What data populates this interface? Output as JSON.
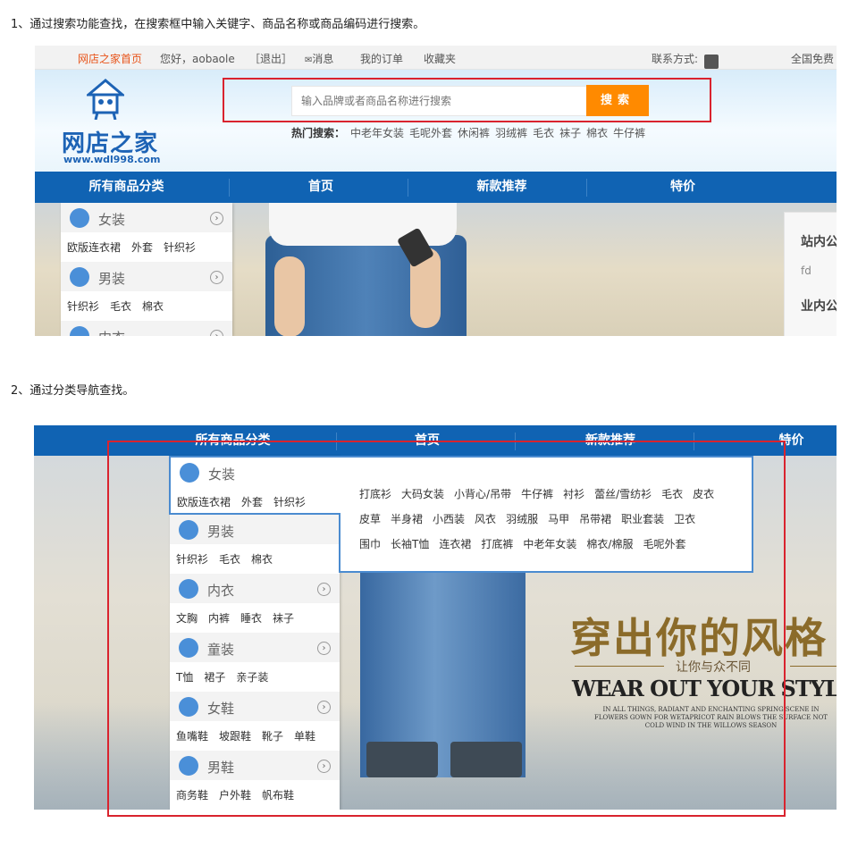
{
  "captions": {
    "step1": "1、通过搜索功能查找，在搜索框中输入关键字、商品名称或商品编码进行搜索。",
    "step2": "2、通过分类导航查找。"
  },
  "topbar": {
    "home": "网店之家首页",
    "greeting": "您好，aobaole",
    "logout": "［退出］",
    "messages": "消息",
    "orders": "我的订单",
    "favorites": "收藏夹",
    "contact": "联系方式:",
    "hotline": "全国免费"
  },
  "logo": {
    "name": "网店之家",
    "url": "www.wdl998.com"
  },
  "search": {
    "placeholder": "输入品牌或者商品名称进行搜索",
    "button": "搜索",
    "hot_label": "热门搜索：",
    "hot_terms": [
      "中老年女装",
      "毛呢外套",
      "休闲裤",
      "羽绒裤",
      "毛衣",
      "袜子",
      "棉衣",
      "牛仔裤"
    ]
  },
  "nav": {
    "all": "所有商品分类",
    "home": "首页",
    "new": "新款推荐",
    "sale": "特价"
  },
  "notice": {
    "site": "站内公",
    "item": "fd",
    "industry": "业内公"
  },
  "categories": [
    {
      "title": "女装",
      "icon": "dress-icon",
      "subs": [
        "欧版连衣裙",
        "外套",
        "针织衫"
      ]
    },
    {
      "title": "男装",
      "icon": "shirt-icon",
      "subs": [
        "针织衫",
        "毛衣",
        "棉衣"
      ]
    },
    {
      "title": "内衣",
      "icon": "underwear-icon",
      "subs": [
        "文胸",
        "内裤",
        "睡衣",
        "袜子"
      ]
    },
    {
      "title": "童装",
      "icon": "child-icon",
      "subs": [
        "T恤",
        "裙子",
        "亲子装"
      ]
    },
    {
      "title": "女鞋",
      "icon": "heel-icon",
      "subs": [
        "鱼嘴鞋",
        "坡跟鞋",
        "靴子",
        "单鞋"
      ]
    },
    {
      "title": "男鞋",
      "icon": "shoe-icon",
      "subs": [
        "商务鞋",
        "户外鞋",
        "帆布鞋"
      ]
    }
  ],
  "menu1_partial": "女装",
  "flyout": {
    "row1": [
      "打底衫",
      "大码女装",
      "小背心/吊带",
      "牛仔裤",
      "衬衫",
      "蕾丝/雪纺衫",
      "毛衣",
      "皮衣"
    ],
    "row2": [
      "皮草",
      "半身裙",
      "小西装",
      "风衣",
      "羽绒服",
      "马甲",
      "吊带裙",
      "职业套装",
      "卫衣"
    ],
    "row3": [
      "围巾",
      "长袖T恤",
      "连衣裙",
      "打底裤",
      "中老年女装",
      "棉衣/棉服",
      "毛呢外套"
    ]
  },
  "banner2": {
    "slogan_cn": "穿出你的风格",
    "slogan_sub": "让你与众不同",
    "slogan_en": "WEAR OUT YOUR STYLE",
    "slogan_small": "IN ALL THINGS, RADIANT AND ENCHANTING SPRING SCENE IN FLOWERS GOWN FOR WETAPRICOT RAIN BLOWS THE SURFACE NOT COLD WIND IN THE WILLOWS SEASON"
  },
  "colors": {
    "nav_blue": "#1063b3",
    "search_orange": "#ff8a00",
    "highlight_red": "#d9232e",
    "flyout_border": "#4a8bd0",
    "home_link": "#e8541a"
  }
}
